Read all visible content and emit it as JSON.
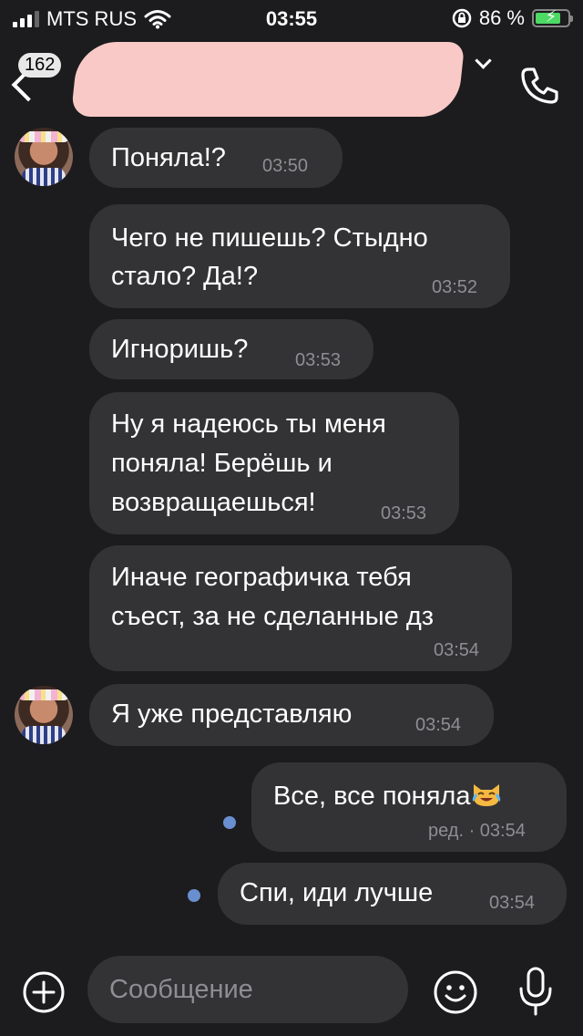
{
  "status_bar": {
    "carrier": "MTS RUS",
    "time": "03:55",
    "battery_percent": "86 %"
  },
  "header": {
    "back_badge": "162"
  },
  "messages": [
    {
      "lines": [
        "Поняла!?"
      ],
      "time": "03:50"
    },
    {
      "lines": [
        "Чего не пишешь? Стыдно",
        "стало? Да!?"
      ],
      "time": "03:52"
    },
    {
      "lines": [
        "Игноришь?"
      ],
      "time": "03:53"
    },
    {
      "lines": [
        "Ну я надеюсь ты меня",
        "поняла! Берёшь и",
        "возвращаешься!"
      ],
      "time": "03:53"
    },
    {
      "lines": [
        "Иначе географичка тебя",
        "съест, за не сделанные дз"
      ],
      "time": "03:54"
    },
    {
      "lines": [
        "Я уже представляю"
      ],
      "time": "03:54"
    },
    {
      "lines": [
        "Все, все поняла"
      ],
      "emoji": "crying-laughing-cat",
      "time": "ред. · 03:54"
    },
    {
      "lines": [
        "Спи, иди лучше"
      ],
      "time": "03:54"
    }
  ],
  "input": {
    "placeholder": "Сообщение"
  },
  "icons": [
    "signal-icon",
    "wifi-icon",
    "lock-rotation-icon",
    "battery-icon",
    "back-icon",
    "chevron-down-icon",
    "phone-icon",
    "plus-icon",
    "emoji-icon",
    "microphone-icon"
  ],
  "colors": {
    "background": "#1c1c1e",
    "bubble": "#333335",
    "unread_dot": "#6a8fd0",
    "time_text": "#8e8e93"
  }
}
